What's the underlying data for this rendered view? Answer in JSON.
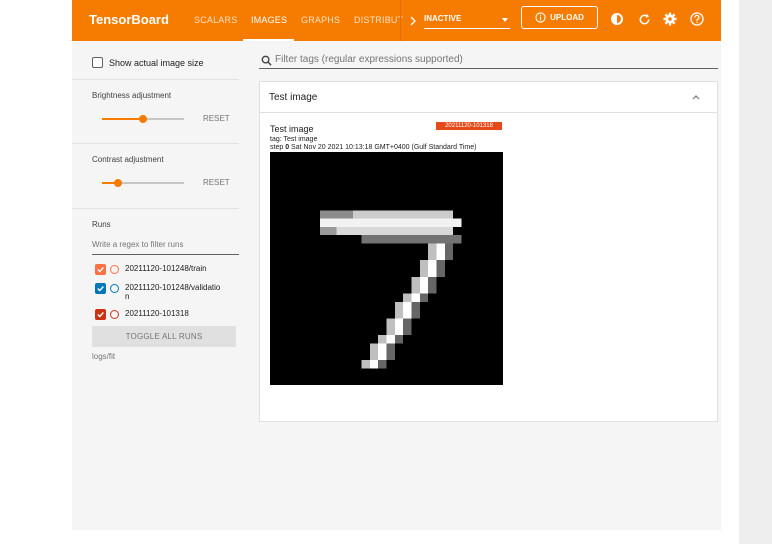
{
  "topbar": {
    "brand": "TensorBoard",
    "tabs": [
      "SCALARS",
      "IMAGES",
      "GRAPHS",
      "DISTRIBUT"
    ],
    "active_tab": "IMAGES",
    "select_value": "INACTIVE",
    "upload_label": "UPLOAD",
    "accent": "#f57c00"
  },
  "sidebar": {
    "show_actual_size": "Show actual image size",
    "brightness": {
      "label": "Brightness adjustment",
      "value": 0.5,
      "reset": "RESET"
    },
    "contrast": {
      "label": "Contrast adjustment",
      "value": 0.2,
      "reset": "RESET"
    },
    "runs_title": "Runs",
    "runs_filter_placeholder": "Write a regex to filter runs",
    "runs": [
      {
        "line1": "20211120-101248/train",
        "line2": "",
        "color": "#ff7043"
      },
      {
        "line1": "20211120-101248/validatio",
        "line2": "n",
        "color": "#0077bb"
      },
      {
        "line1": "20211120-101318",
        "line2": "",
        "color": "#cc3311"
      }
    ],
    "toggle_all": "TOGGLE ALL RUNS",
    "logdir": "logs/fit"
  },
  "main": {
    "filter_placeholder": "Filter tags (regular expressions supported)",
    "card_title": "Test image",
    "image": {
      "name": "Test image",
      "tag": "tag: Test image",
      "step_label": "step",
      "step_value": "0",
      "timestamp": "Sat Nov 20 2021 10:13:18 GMT+0400 (Gulf Standard Time)",
      "run_badge": "20211120-101318"
    }
  }
}
